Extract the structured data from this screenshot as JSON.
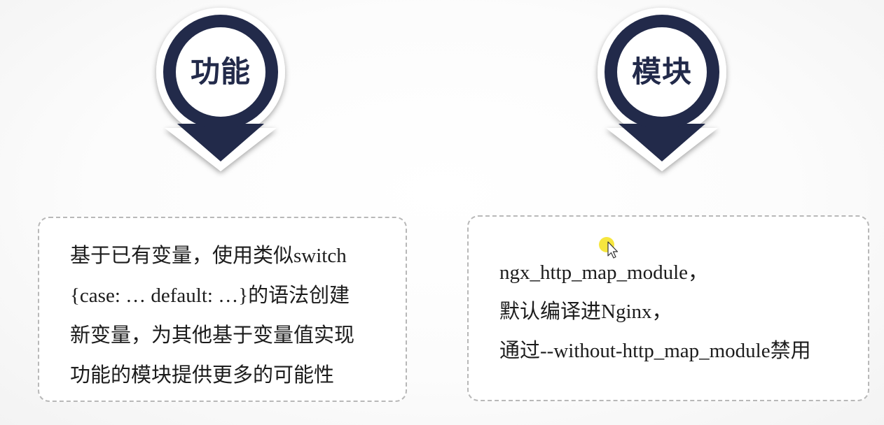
{
  "badges": {
    "left": {
      "label": "功能",
      "icon": "map-pin-down-arrow-icon"
    },
    "right": {
      "label": "模块",
      "icon": "map-pin-down-arrow-icon"
    }
  },
  "cards": {
    "function": {
      "lines": [
        "基于已有变量，使用类似switch",
        "{case: … default: …}的语法创建",
        "新变量，为其他基于变量值实现",
        "功能的模块提供更多的可能性"
      ]
    },
    "module": {
      "lines": [
        "ngx_http_map_module，",
        "默认编译进Nginx，",
        "通过--without-http_map_module禁用"
      ]
    }
  },
  "colors": {
    "badge_navy": "#222a4a",
    "badge_ring": "#ffffff",
    "card_border": "#b8b8b8",
    "cursor_highlight": "#f5e21c"
  }
}
